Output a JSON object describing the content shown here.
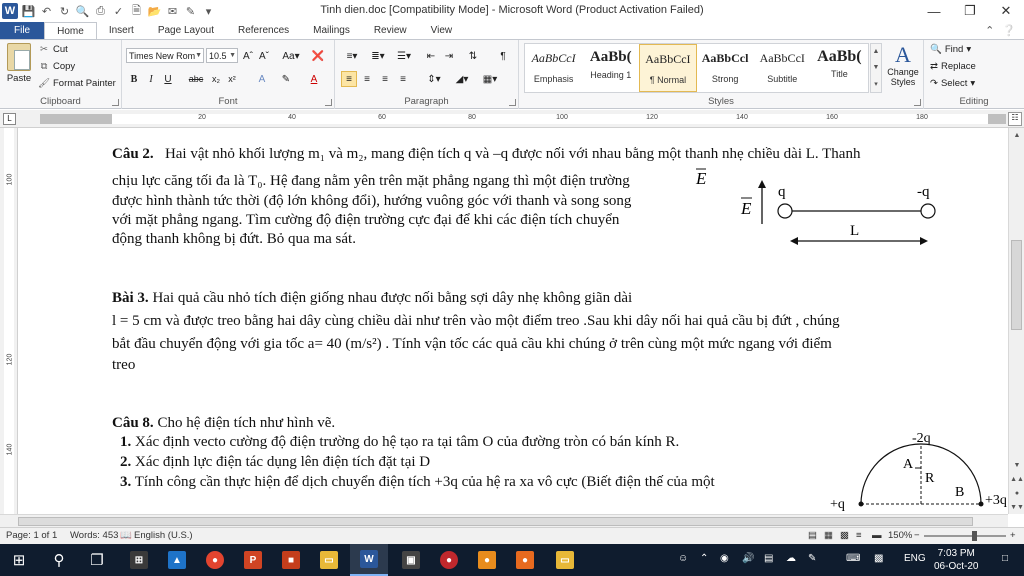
{
  "window": {
    "title": "Tinh dien.doc [Compatibility Mode]  -  Microsoft Word (Product Activation Failed)",
    "app_logo": "W"
  },
  "tabs": [
    "File",
    "Home",
    "Insert",
    "Page Layout",
    "References",
    "Mailings",
    "Review",
    "View"
  ],
  "ribbon": {
    "clipboard": {
      "paste": "Paste",
      "cut": "Cut",
      "copy": "Copy",
      "format_painter": "Format Painter",
      "label": "Clipboard"
    },
    "font": {
      "font_name": "Times New Rom",
      "font_size": "10.5",
      "label": "Font"
    },
    "paragraph": {
      "label": "Paragraph"
    },
    "styles": {
      "label": "Styles",
      "items": [
        {
          "sample": "AaBbCcI",
          "name": "Emphasis"
        },
        {
          "sample": "AaBb(",
          "name": "Heading 1"
        },
        {
          "sample": "AaBbCcI",
          "name": "¶ Normal"
        },
        {
          "sample": "AaBbCcl",
          "name": "Strong"
        },
        {
          "sample": "AaBbCcI",
          "name": "Subtitle"
        },
        {
          "sample": "AaBb(",
          "name": "Title"
        }
      ],
      "change_styles": "Change Styles"
    },
    "editing": {
      "label": "Editing",
      "find": "Find",
      "replace": "Replace",
      "select": "Select"
    }
  },
  "ruler": {
    "numbers": [
      "20",
      "40",
      "60",
      "80",
      "100",
      "120",
      "140",
      "160",
      "180"
    ]
  },
  "vruler": {
    "numbers": [
      "100",
      "120",
      "140"
    ]
  },
  "doc": {
    "q2_head": "Câu 2.",
    "q2_l1": "Hai vật nhỏ khối lượng m₁ và m₂, mang điện tích q và –q được nối với nhau bằng một thanh nhẹ chiều dài L. Thanh",
    "q2_l2": "chịu lực căng tối đa là T₀. Hệ đang nằm yên trên mặt phẳng ngang thì một điện trường",
    "q2_l3": "được hình thành tức thời (độ lớn không đổi), hướng vuông góc với thanh và song song",
    "q2_l4": "với mặt phẳng ngang. Tìm cường độ điện trường cực đại để khi các điện tích chuyển",
    "q2_l5": "động thanh không bị đứt. Bỏ qua ma sát.",
    "fig1": {
      "E": "E",
      "q": "q",
      "mq": "-q",
      "L": "L"
    },
    "b3_head": "Bài 3.",
    "b3_l1": "Hai quả cầu nhỏ tích điện giống nhau được nối bằng sợi dây nhẹ không giãn dài",
    "b3_l2": "l = 5 cm và được treo bằng hai dây cùng chiều dài như trên vào một điểm treo .Sau khi dây nối hai quả cầu bị đứt , chúng",
    "b3_l3": "bắt đầu chuyển động với gia tốc  a= 40 (m/s²) . Tính vận tốc các quả cầu khi chúng ở trên cùng một mức ngang với điểm",
    "b3_l4": "treo",
    "q8_head": "Câu 8.",
    "q8_l1": "Cho hệ điện tích như hình vẽ.",
    "q8_items": [
      {
        "num": "1.",
        "text": "Xác định vecto cường độ điện trường do hệ tạo ra tại tâm O của đường tròn có bán kính R."
      },
      {
        "num": "2.",
        "text": "Xác định lực điện tác dụng lên điện tích đặt tại D"
      },
      {
        "num": "3.",
        "text": "Tính công cần thực hiện để dịch chuyển điện tích +3q của hệ ra xa vô cực (Biết điện thế của một"
      }
    ],
    "fig2": {
      "top": "-2q",
      "A": "A",
      "R": "R",
      "B": "B",
      "left": "+q",
      "right": "+3q"
    }
  },
  "status": {
    "page": "Page: 1 of 1",
    "words": "Words: 453",
    "lang": "English (U.S.)",
    "zoom": "150%",
    "zoom_fraction": 0.62
  },
  "taskbar": {
    "lang": "ENG",
    "time": "7:03 PM",
    "date": "06-Oct-20"
  }
}
